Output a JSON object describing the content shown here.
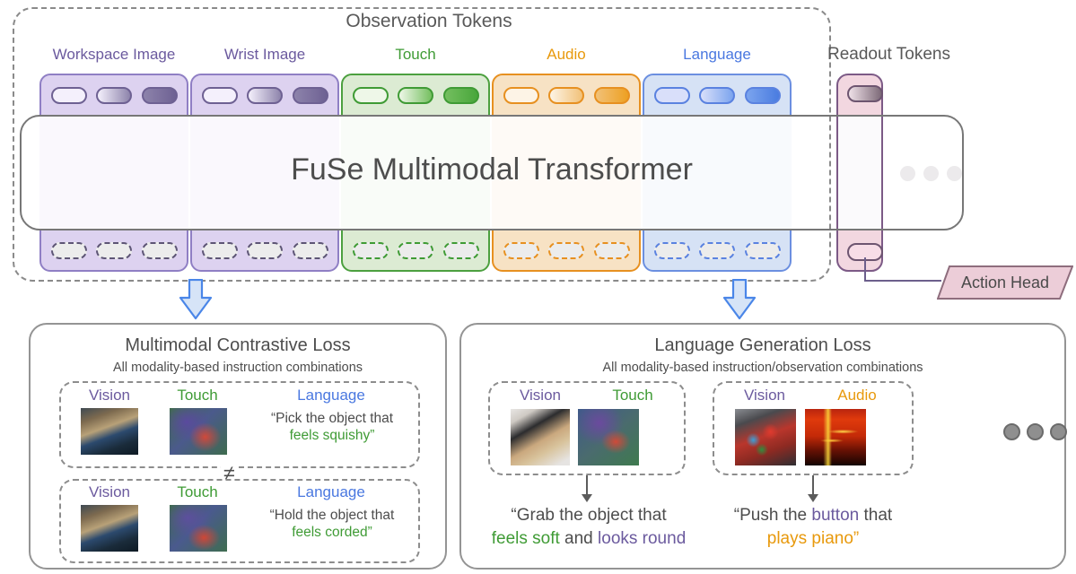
{
  "observation": {
    "title": "Observation Tokens",
    "readout_title": "Readout Tokens",
    "columns": [
      {
        "label": "Workspace Image",
        "color": "#6b5a9e",
        "border": "#8f7fc4",
        "fill": "#ddd2f0",
        "pill_light": "#eee8fa",
        "pill_dark": "#6e6193",
        "tokens": 3
      },
      {
        "label": "Wrist Image",
        "color": "#6b5a9e",
        "border": "#8f7fc4",
        "fill": "#ddd2f0",
        "pill_light": "#eee8fa",
        "pill_dark": "#6e6193",
        "tokens": 3
      },
      {
        "label": "Touch",
        "color": "#3f9b35",
        "border": "#4ca03f",
        "fill": "#dcebd3",
        "pill_light": "#eef7e8",
        "pill_dark": "#3f9b35",
        "tokens": 3
      },
      {
        "label": "Audio",
        "color": "#e8990c",
        "border": "#e79020",
        "fill": "#f7e2c4",
        "pill_light": "#fdf1dd",
        "pill_dark": "#eda022",
        "tokens": 3
      },
      {
        "label": "Language",
        "color": "#4a78e0",
        "border": "#6b8fe0",
        "fill": "#d6e2f5",
        "pill_light": "#e3eafb",
        "pill_dark": "#4a7ce0",
        "tokens": 3
      }
    ]
  },
  "transformer": {
    "title": "FuSe Multimodal Transformer",
    "ellipsis": "three-dots"
  },
  "action_head": {
    "label": "Action Head"
  },
  "losses": {
    "left": {
      "title": "Multimodal Contrastive Loss",
      "subtitle": "All modality-based instruction combinations",
      "relation": "≠",
      "examples": [
        {
          "modalities": [
            {
              "label": "Vision",
              "color": "#6b5a9e"
            },
            {
              "label": "Touch",
              "color": "#3f9b35"
            },
            {
              "label": "Language",
              "color": "#4a78e0"
            }
          ],
          "quote_line1": "“Pick the object that",
          "quote_highlight": "feels squishy”",
          "highlight_color": "#3f9b35"
        },
        {
          "modalities": [
            {
              "label": "Vision",
              "color": "#6b5a9e"
            },
            {
              "label": "Touch",
              "color": "#3f9b35"
            },
            {
              "label": "Language",
              "color": "#4a78e0"
            }
          ],
          "quote_line1": "“Hold the object that",
          "quote_highlight": "feels corded”",
          "highlight_color": "#3f9b35"
        }
      ]
    },
    "right": {
      "title": "Language Generation Loss",
      "subtitle": "All modality-based instruction/observation combinations",
      "examples": [
        {
          "modalities": [
            {
              "label": "Vision",
              "color": "#6b5a9e"
            },
            {
              "label": "Touch",
              "color": "#3f9b35"
            }
          ],
          "out_pre": "“Grab the object that",
          "out_seg1": "feels soft",
          "out_seg1_color": "#3f9b35",
          "out_mid": " and ",
          "out_seg2": "looks round",
          "out_seg2_color": "#6b5a9e"
        },
        {
          "modalities": [
            {
              "label": "Vision",
              "color": "#6b5a9e"
            },
            {
              "label": "Audio",
              "color": "#e8990c"
            }
          ],
          "out_pre_a": "“Push the ",
          "out_seg_b": "button",
          "out_seg_b_color": "#6b5a9e",
          "out_pre_c": " that",
          "out_seg2": "plays piano”",
          "out_seg2_color": "#e8990c"
        }
      ],
      "ellipsis": "three-dots"
    }
  }
}
